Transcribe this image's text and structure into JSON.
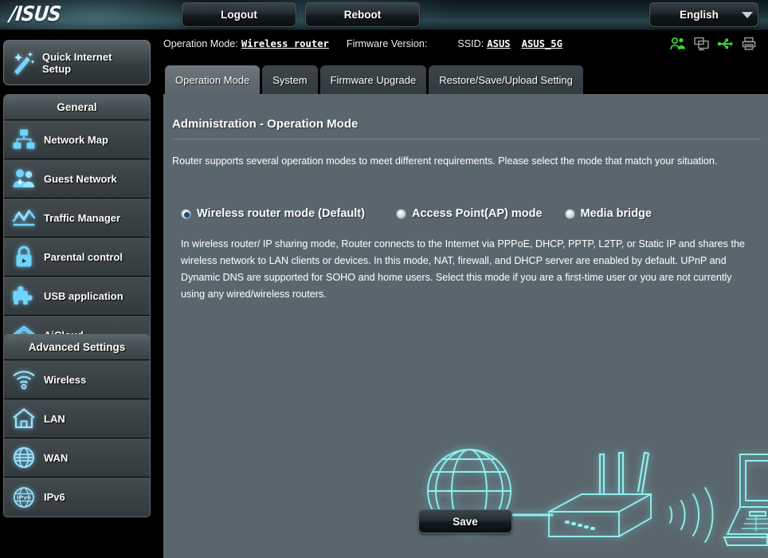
{
  "brand": {
    "logo_text": "/ISUS"
  },
  "header": {
    "logout_label": "Logout",
    "reboot_label": "Reboot",
    "language": "English",
    "caret_icon": "chevron-down-icon"
  },
  "info_bar": {
    "operation_mode_label": "Operation Mode:",
    "operation_mode_value": "Wireless router",
    "firmware_label": "Firmware Version:",
    "firmware_value": "",
    "ssid_label": "SSID:",
    "ssid_1": "ASUS",
    "ssid_2": "ASUS_5G"
  },
  "status_icons": [
    {
      "name": "clients-icon",
      "color": "#35d935"
    },
    {
      "name": "devices-icon",
      "color": "#8d9699"
    },
    {
      "name": "usb-icon",
      "color": "#35d935"
    },
    {
      "name": "printer-icon",
      "color": "#8d9699"
    }
  ],
  "sidebar": {
    "quick_setup": {
      "label": "Quick Internet Setup",
      "icon": "magic-wand-icon"
    },
    "groups": [
      {
        "title": "General",
        "items": [
          {
            "label": "Network Map",
            "icon": "network-map-icon"
          },
          {
            "label": "Guest Network",
            "icon": "guest-network-icon"
          },
          {
            "label": "Traffic Manager",
            "icon": "traffic-manager-icon"
          },
          {
            "label": "Parental control",
            "icon": "lock-icon"
          },
          {
            "label": "USB application",
            "icon": "puzzle-icon"
          },
          {
            "label": "AiCloud",
            "icon": "cloud-house-icon"
          }
        ]
      },
      {
        "title": "Advanced Settings",
        "items": [
          {
            "label": "Wireless",
            "icon": "wifi-icon"
          },
          {
            "label": "LAN",
            "icon": "house-icon"
          },
          {
            "label": "WAN",
            "icon": "globe-icon"
          },
          {
            "label": "IPv6",
            "icon": "ipv6-globe-icon"
          }
        ]
      }
    ]
  },
  "tabs": [
    {
      "label": "Operation Mode",
      "active": true
    },
    {
      "label": "System",
      "active": false
    },
    {
      "label": "Firmware Upgrade",
      "active": false
    },
    {
      "label": "Restore/Save/Upload Setting",
      "active": false
    }
  ],
  "main": {
    "title": "Administration - Operation Mode",
    "description": "Router supports several operation modes to meet different requirements. Please select the mode that match your situation.",
    "modes": [
      {
        "label": "Wireless router mode (Default)",
        "checked": true
      },
      {
        "label": "Access Point(AP) mode",
        "checked": false
      },
      {
        "label": "Media bridge",
        "checked": false
      }
    ],
    "mode_description": "In wireless router/ IP sharing mode, Router connects to the Internet via PPPoE, DHCP, PPTP, L2TP, or Static IP and shares the wireless network to LAN clients or devices. In this mode, NAT, firewall, and DHCP server are enabled by default. UPnP and Dynamic DNS are supported for SOHO and home users. Select this mode if you are a first-time user or you are not currently using any wired/wireless routers.",
    "diagram": {
      "name": "network-topology-illustration",
      "elements": [
        "globe-icon",
        "router-icon",
        "wifi-waves-icon",
        "laptop-icon"
      ],
      "color": "#8ff0ee"
    },
    "save_label": "Save"
  },
  "colors": {
    "content_bg": "#5a666d",
    "sidebar_item_bg": "#3a4245",
    "accent_cyan": "#7fe3ff",
    "page_bg": "#000000"
  }
}
